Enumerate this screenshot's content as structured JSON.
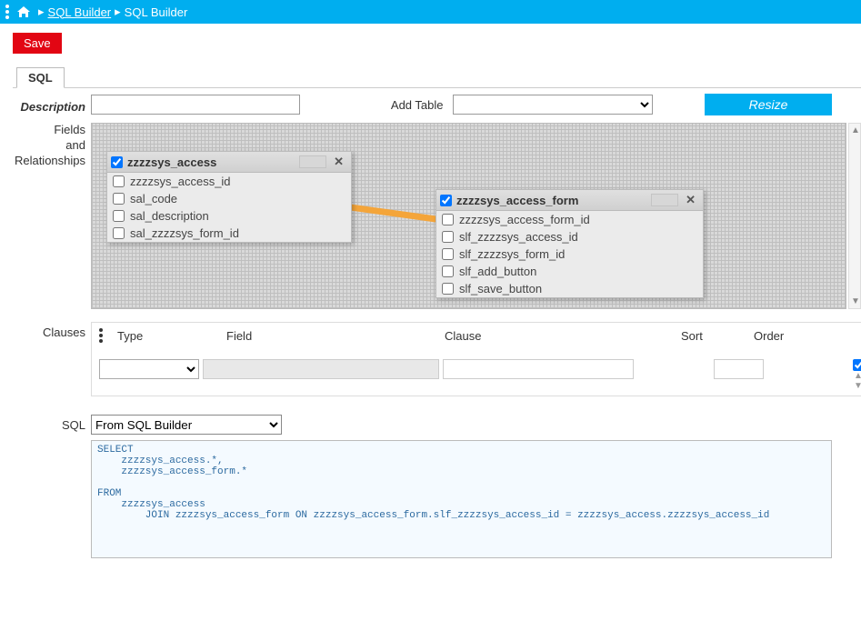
{
  "breadcrumb": {
    "link": "SQL Builder",
    "page": "SQL Builder"
  },
  "buttons": {
    "save": "Save",
    "resize": "Resize"
  },
  "tabs": {
    "sql": "SQL"
  },
  "labels": {
    "description": "Description",
    "add_table": "Add Table",
    "fields": "Fields\nand\nRelationships",
    "clauses": "Clauses",
    "sql": "SQL"
  },
  "inputs": {
    "description_value": "",
    "add_table_value": "",
    "sql_source_value": "From SQL Builder"
  },
  "tables": {
    "t1": {
      "name": "zzzzsys_access",
      "checked": true,
      "fields": [
        {
          "name": "zzzzsys_access_id",
          "checked": false
        },
        {
          "name": "sal_code",
          "checked": false
        },
        {
          "name": "sal_description",
          "checked": false
        },
        {
          "name": "sal_zzzzsys_form_id",
          "checked": false
        }
      ]
    },
    "t2": {
      "name": "zzzzsys_access_form",
      "checked": true,
      "fields": [
        {
          "name": "zzzzsys_access_form_id",
          "checked": false
        },
        {
          "name": "slf_zzzzsys_access_id",
          "checked": false
        },
        {
          "name": "slf_zzzzsys_form_id",
          "checked": false
        },
        {
          "name": "slf_add_button",
          "checked": false
        },
        {
          "name": "slf_save_button",
          "checked": false
        }
      ]
    }
  },
  "clauses": {
    "columns": {
      "type": "Type",
      "field": "Field",
      "clause": "Clause",
      "sort": "Sort",
      "order": "Order"
    },
    "row_checked": true
  },
  "sql_text": "SELECT\n    zzzzsys_access.*,\n    zzzzsys_access_form.*\n\nFROM\n    zzzzsys_access\n        JOIN zzzzsys_access_form ON zzzzsys_access_form.slf_zzzzsys_access_id = zzzzsys_access.zzzzsys_access_id\n"
}
